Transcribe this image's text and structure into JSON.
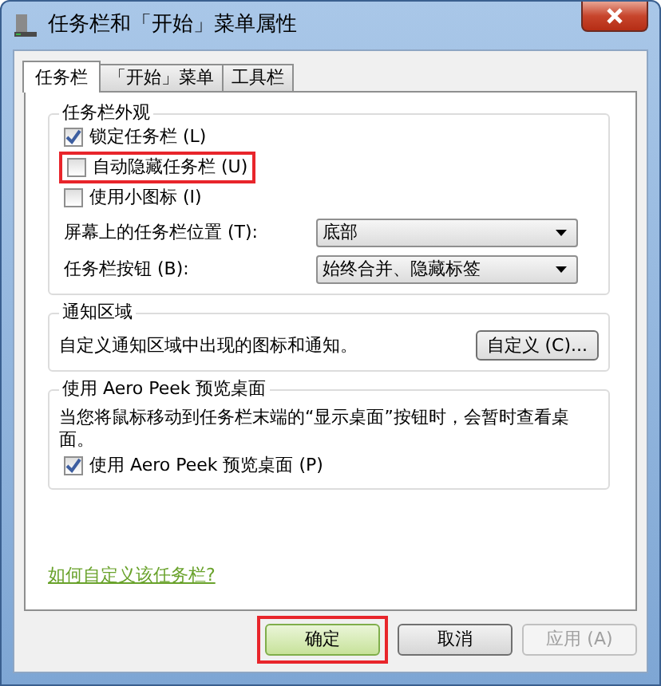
{
  "window": {
    "title": "任务栏和「开始」菜单属性"
  },
  "tabs": [
    {
      "label": "任务栏",
      "selected": true
    },
    {
      "label": "「开始」菜单",
      "selected": false
    },
    {
      "label": "工具栏",
      "selected": false
    }
  ],
  "appearance": {
    "title": "任务栏外观",
    "checkboxes": [
      {
        "label": "锁定任务栏 (L)",
        "checked": true,
        "highlighted": false
      },
      {
        "label": "自动隐藏任务栏 (U)",
        "checked": false,
        "highlighted": true
      },
      {
        "label": "使用小图标 (I)",
        "checked": false,
        "highlighted": false
      }
    ],
    "selects": [
      {
        "label": "屏幕上的任务栏位置 (T):",
        "value": "底部"
      },
      {
        "label": "任务栏按钮 (B):",
        "value": "始终合并、隐藏标签"
      }
    ]
  },
  "notification_area": {
    "title": "通知区域",
    "description": "自定义通知区域中出现的图标和通知。",
    "button": "自定义 (C)..."
  },
  "aero_peek": {
    "title": "使用 Aero Peek 预览桌面",
    "description": "当您将鼠标移动到任务栏末端的“显示桌面”按钮时，会暂时查看桌面。",
    "checkbox": {
      "label": "使用 Aero Peek 预览桌面 (P)",
      "checked": true
    }
  },
  "help_link": "如何自定义该任务栏?",
  "buttons": [
    {
      "label": "确定",
      "default": true,
      "disabled": false,
      "highlighted": true
    },
    {
      "label": "取消",
      "default": false,
      "disabled": false,
      "highlighted": false
    },
    {
      "label": "应用 (A)",
      "default": false,
      "disabled": true,
      "highlighted": false
    }
  ]
}
